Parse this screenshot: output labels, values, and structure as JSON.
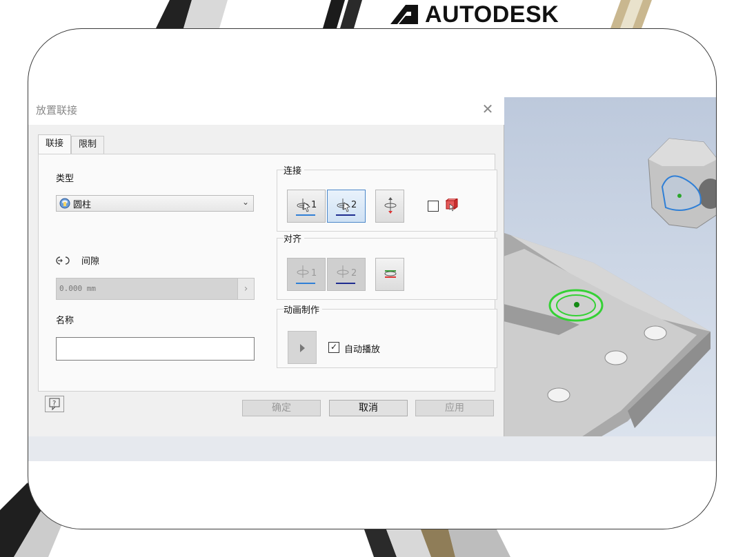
{
  "brand": {
    "name": "AUTODESK"
  },
  "dialog": {
    "title": "放置联接",
    "close_glyph": "✕",
    "tabs": [
      {
        "label": "联接",
        "active": true
      },
      {
        "label": "限制",
        "active": false
      }
    ],
    "type_label": "类型",
    "type_select_value": "圆柱",
    "gap_label": "间隙",
    "gap_value": "0.000 mm",
    "gap_arrow": "›",
    "name_label": "名称",
    "name_value": "",
    "connect_group": {
      "title": "连接",
      "buttons": [
        {
          "label": "1",
          "icon": "pick-origin-1-icon",
          "selected": false
        },
        {
          "label": "2",
          "icon": "pick-origin-2-icon",
          "selected": true
        },
        {
          "label": "",
          "icon": "flip-component-icon",
          "selected": false
        }
      ],
      "checkbox_checked": false
    },
    "align_group": {
      "title": "对齐",
      "buttons": [
        {
          "label": "1",
          "icon": "align-1-icon",
          "disabled": true
        },
        {
          "label": "2",
          "icon": "align-2-icon",
          "disabled": true
        },
        {
          "label": "",
          "icon": "flip-align-icon",
          "disabled": false
        }
      ]
    },
    "animate_group": {
      "title": "动画制作",
      "autoplay_label": "自动播放",
      "autoplay_checked": true
    },
    "footer": {
      "ok_label": "确定",
      "cancel_label": "取消",
      "apply_label": "应用",
      "help_icon": "help-icon"
    }
  },
  "colors": {
    "selected_button": "#cfe1f4",
    "selection_blue": "#4a86c8",
    "highlight_green": "#35d135",
    "viewport_bg": "#ccd6e5"
  }
}
